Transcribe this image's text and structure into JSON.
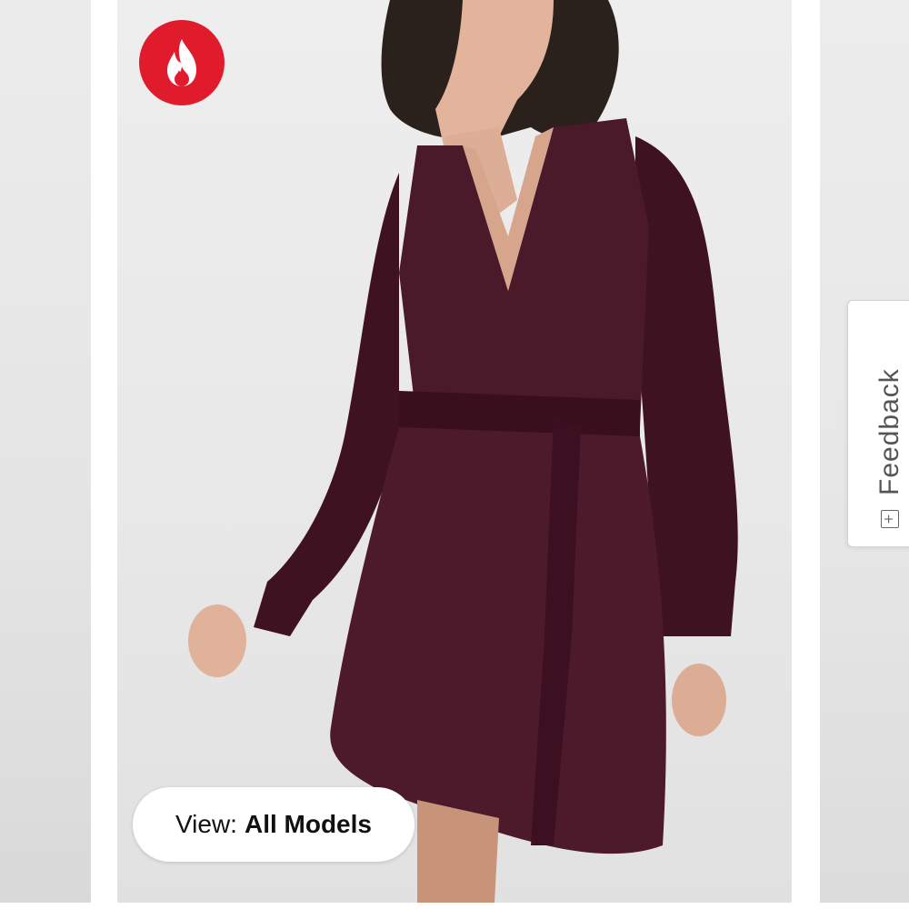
{
  "badge": {
    "icon": "flame-icon",
    "color": "#e01c2c"
  },
  "view_toggle": {
    "label": "View:",
    "value": "All Models"
  },
  "feedback": {
    "label": "Feedback",
    "icon": "plus-box-icon",
    "icon_glyph": "+"
  },
  "product_image": {
    "dress_color": "#4a1a2a"
  }
}
